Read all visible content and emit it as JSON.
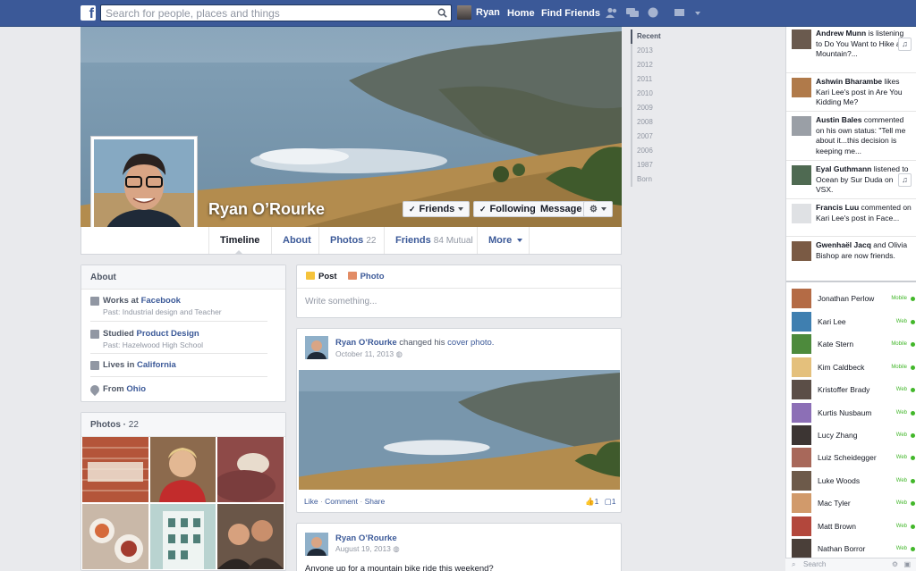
{
  "topbar": {
    "logo": "f",
    "search_placeholder": "Search for people, places and things",
    "user_name": "Ryan",
    "home": "Home",
    "find_friends": "Find Friends"
  },
  "profile": {
    "name": "Ryan O’Rourke",
    "friends_btn": "Friends",
    "following_btn": "Following",
    "message_btn": "Message"
  },
  "tabs": [
    {
      "label": "Timeline",
      "count": ""
    },
    {
      "label": "About",
      "count": ""
    },
    {
      "label": "Photos",
      "count": "22"
    },
    {
      "label": "Friends",
      "count": "84 Mutual"
    },
    {
      "label": "More",
      "count": ""
    }
  ],
  "about": {
    "header": "About",
    "work_prefix": "Works at ",
    "work_place": "Facebook",
    "work_past": "Past: Industrial design and Teacher",
    "study_prefix": "Studied ",
    "study_field": "Product Design",
    "study_past": "Past: Hazelwood High School",
    "lives_prefix": "Lives in ",
    "lives_place": "California",
    "from_prefix": "From ",
    "from_place": "Ohio"
  },
  "photos_card": {
    "header": "Photos",
    "count": "22"
  },
  "composer": {
    "post_tab": "Post",
    "photo_tab": "Photo",
    "placeholder": "Write something..."
  },
  "story1": {
    "author": "Ryan O’Rourke",
    "action": " changed his ",
    "object": "cover photo.",
    "date": "October 11, 2013",
    "like": "Like",
    "comment": "Comment",
    "share": "Share",
    "sep": " · ",
    "likes_count": "1",
    "comments_count": "1"
  },
  "story2": {
    "author": "Ryan O’Rourke",
    "date": "August 19, 2013",
    "text": "Anyone up for a mountain bike ride this weekend?"
  },
  "years": [
    "Recent",
    "2013",
    "2012",
    "2011",
    "2010",
    "2009",
    "2008",
    "2007",
    "2006",
    "1987",
    "Born"
  ],
  "ticker": [
    {
      "name": "Andrew Munn",
      "text": " is listening to Do You Want to Hike a Mountain?...",
      "badge": "♫"
    },
    {
      "name": "Ashwin Bharambe",
      "text": " likes Kari Lee's post in Are You Kidding Me?",
      "badge": ""
    },
    {
      "name": "Austin Bales",
      "text": " commented on his own status: \"Tell me about it...this decision is keeping me...",
      "badge": ""
    },
    {
      "name": "Eyal Guthmann",
      "text": " listened to Ocean by Sur Duda on VSX.",
      "badge": "♫"
    },
    {
      "name": "Francis Luu",
      "text": " commented on Kari Lee's post in Face...",
      "badge": ""
    },
    {
      "name": "Gwenhaël Jacq",
      "text": " and Olivia Bishop are now friends.",
      "badge": ""
    }
  ],
  "chat": [
    {
      "name": "Jonathan Perlow",
      "status": "Mobile"
    },
    {
      "name": "Kari Lee",
      "status": "Web"
    },
    {
      "name": "Kate Stern",
      "status": "Mobile"
    },
    {
      "name": "Kim Caldbeck",
      "status": "Mobile"
    },
    {
      "name": "Kristoffer Brady",
      "status": "Web"
    },
    {
      "name": "Kurtis Nusbaum",
      "status": "Web"
    },
    {
      "name": "Lucy Zhang",
      "status": "Web"
    },
    {
      "name": "Luiz Scheidegger",
      "status": "Web"
    },
    {
      "name": "Luke Woods",
      "status": "Web"
    },
    {
      "name": "Mac Tyler",
      "status": "Web"
    },
    {
      "name": "Matt Brown",
      "status": "Web"
    },
    {
      "name": "Nathan Borror",
      "status": "Web"
    }
  ],
  "chat_search": "Search",
  "colors": {
    "brand": "#3b5998",
    "online": "#42b72a",
    "background": "#e9eaed"
  }
}
